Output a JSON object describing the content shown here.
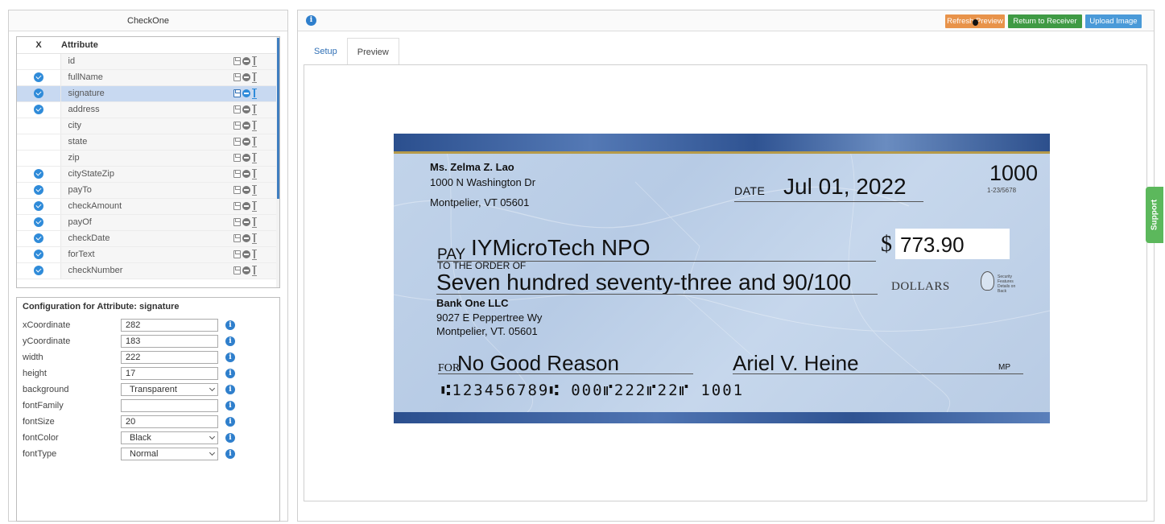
{
  "left_panel": {
    "title": "CheckOne",
    "columns": {
      "x": "X",
      "attribute": "Attribute"
    },
    "attributes": [
      {
        "name": "id",
        "checked": false,
        "selected": false
      },
      {
        "name": "fullName",
        "checked": true,
        "selected": false
      },
      {
        "name": "signature",
        "checked": true,
        "selected": true
      },
      {
        "name": "address",
        "checked": true,
        "selected": false
      },
      {
        "name": "city",
        "checked": false,
        "selected": false
      },
      {
        "name": "state",
        "checked": false,
        "selected": false
      },
      {
        "name": "zip",
        "checked": false,
        "selected": false
      },
      {
        "name": "cityStateZip",
        "checked": true,
        "selected": false
      },
      {
        "name": "payTo",
        "checked": true,
        "selected": false
      },
      {
        "name": "checkAmount",
        "checked": true,
        "selected": false
      },
      {
        "name": "payOf",
        "checked": true,
        "selected": false
      },
      {
        "name": "checkDate",
        "checked": true,
        "selected": false
      },
      {
        "name": "forText",
        "checked": true,
        "selected": false
      },
      {
        "name": "checkNumber",
        "checked": true,
        "selected": false
      }
    ],
    "row_icons": [
      "save-icon",
      "remove-icon",
      "resize-icon"
    ],
    "config": {
      "title": "Configuration for Attribute: signature",
      "fields": [
        {
          "label": "xCoordinate",
          "type": "text",
          "value": "282"
        },
        {
          "label": "yCoordinate",
          "type": "text",
          "value": "183"
        },
        {
          "label": "width",
          "type": "text",
          "value": "222"
        },
        {
          "label": "height",
          "type": "text",
          "value": "17"
        },
        {
          "label": "background",
          "type": "select",
          "value": "Transparent"
        },
        {
          "label": "fontFamily",
          "type": "text",
          "value": ""
        },
        {
          "label": "fontSize",
          "type": "text",
          "value": "20"
        },
        {
          "label": "fontColor",
          "type": "select",
          "value": "Black"
        },
        {
          "label": "fontType",
          "type": "select",
          "value": "Normal"
        }
      ]
    }
  },
  "toolbar": {
    "refresh_label": "Refresh Preview",
    "return_label": "Return to Receiver",
    "upload_label": "Upload Image",
    "colors": {
      "refresh": "#e8934a",
      "return": "#3f9a44",
      "upload": "#4a9ad8"
    }
  },
  "tabs": [
    {
      "label": "Setup",
      "active": false
    },
    {
      "label": "Preview",
      "active": true
    }
  ],
  "check": {
    "owner_name": "Ms. Zelma Z. Lao",
    "owner_address1": "1000 N Washington Dr",
    "owner_address2": "Montpelier, VT 05601",
    "date_label": "DATE",
    "date": "Jul 01, 2022",
    "check_number": "1000",
    "routing_fraction": "1-23/5678",
    "pay_label": "PAY",
    "payee": "IYMicroTech NPO",
    "to_the_order_of": "TO THE ORDER OF",
    "dollar_sign": "$",
    "amount": "773.90",
    "amount_words": "Seven hundred seventy-three and 90/100",
    "dollars_label": "DOLLARS",
    "security_text": "Security Features Details on Back",
    "bank_name": "Bank One LLC",
    "bank_address1": "9027 E Peppertree Wy",
    "bank_address2": "Montpelier, VT. 05601",
    "for_label": "FOR",
    "memo": "No Good Reason",
    "signature": "Ariel V. Heine",
    "mp_label": "MP",
    "micr_line": "⑆123456789⑆  000⑈222⑈22⑈  1001"
  },
  "support_label": "Support"
}
